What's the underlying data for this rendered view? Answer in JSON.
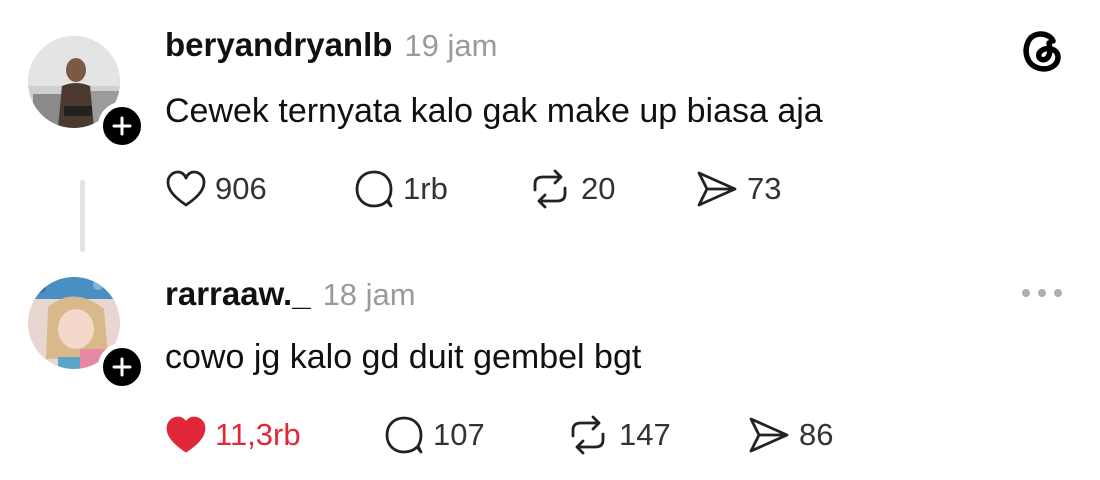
{
  "posts": [
    {
      "username": "beryandryanlb",
      "timestamp": "19 jam",
      "text": "Cewek ternyata kalo gak make up biasa aja",
      "actions": {
        "likes": "906",
        "replies": "1rb",
        "reposts": "20",
        "shares": "73"
      },
      "liked": false,
      "header_icon": "threads-logo-icon"
    },
    {
      "username": "rarraaw._",
      "timestamp": "18 jam",
      "text": "cowo jg kalo gd duit gembel bgt",
      "actions": {
        "likes": "11,3rb",
        "replies": "107",
        "reposts": "147",
        "shares": "86"
      },
      "liked": true,
      "header_icon": "more-options-icon"
    }
  ],
  "colors": {
    "liked_heart": "#e0283a",
    "timestamp": "#9a9a9a",
    "thread_line": "#e3e3e3"
  }
}
